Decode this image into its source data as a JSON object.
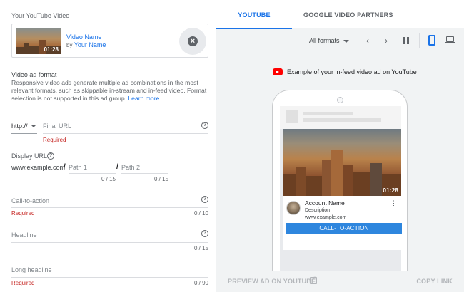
{
  "video": {
    "section_title": "Your YouTube Video",
    "name": "Video Name",
    "by_prefix": "by",
    "channel": "Your Name",
    "duration": "01:28",
    "close_icon": "close-circle-icon"
  },
  "ad_format": {
    "title": "Video ad format",
    "description": "Responsive video ads generate multiple ad combinations in the most relevant formats, such as skippable in-stream and in-feed video. Format selection is not supported in this ad group.",
    "learn_more": "Learn more"
  },
  "final_url": {
    "protocol": "http://",
    "placeholder": "Final URL",
    "required": "Required"
  },
  "display_url": {
    "label": "Display URL",
    "domain": "www.example.com",
    "slash": "/",
    "path1": "Path 1",
    "path1_count": "0 / 15",
    "path2": "Path 2",
    "path2_count": "0 / 15"
  },
  "call_to_action": {
    "placeholder": "Call-to-action",
    "required": "Required",
    "count": "0 / 10"
  },
  "headline": {
    "placeholder": "Headline",
    "count": "0 / 15"
  },
  "long_headline": {
    "placeholder": "Long headline",
    "required": "Required",
    "count": "0 / 90"
  },
  "tabs": {
    "youtube": "YOUTUBE",
    "gvp": "GOOGLE VIDEO PARTNERS"
  },
  "toolbar": {
    "format": "All formats",
    "prev": "‹",
    "next": "›"
  },
  "preview": {
    "caption": "Example of your in-feed video ad on YouTube",
    "duration": "01:28",
    "account_name": "Account Name",
    "description": "Description",
    "url": "www.example.com",
    "kebab": "⋮",
    "cta": "CALL-TO-ACTION"
  },
  "footer": {
    "preview_on_youtube": "PREVIEW AD ON YOUTUBE",
    "copy_link": "COPY LINK"
  },
  "colors": {
    "accent": "#1a73e8",
    "error": "#c5221f",
    "youtube_red": "#ff0000",
    "cta": "#2e86de"
  }
}
